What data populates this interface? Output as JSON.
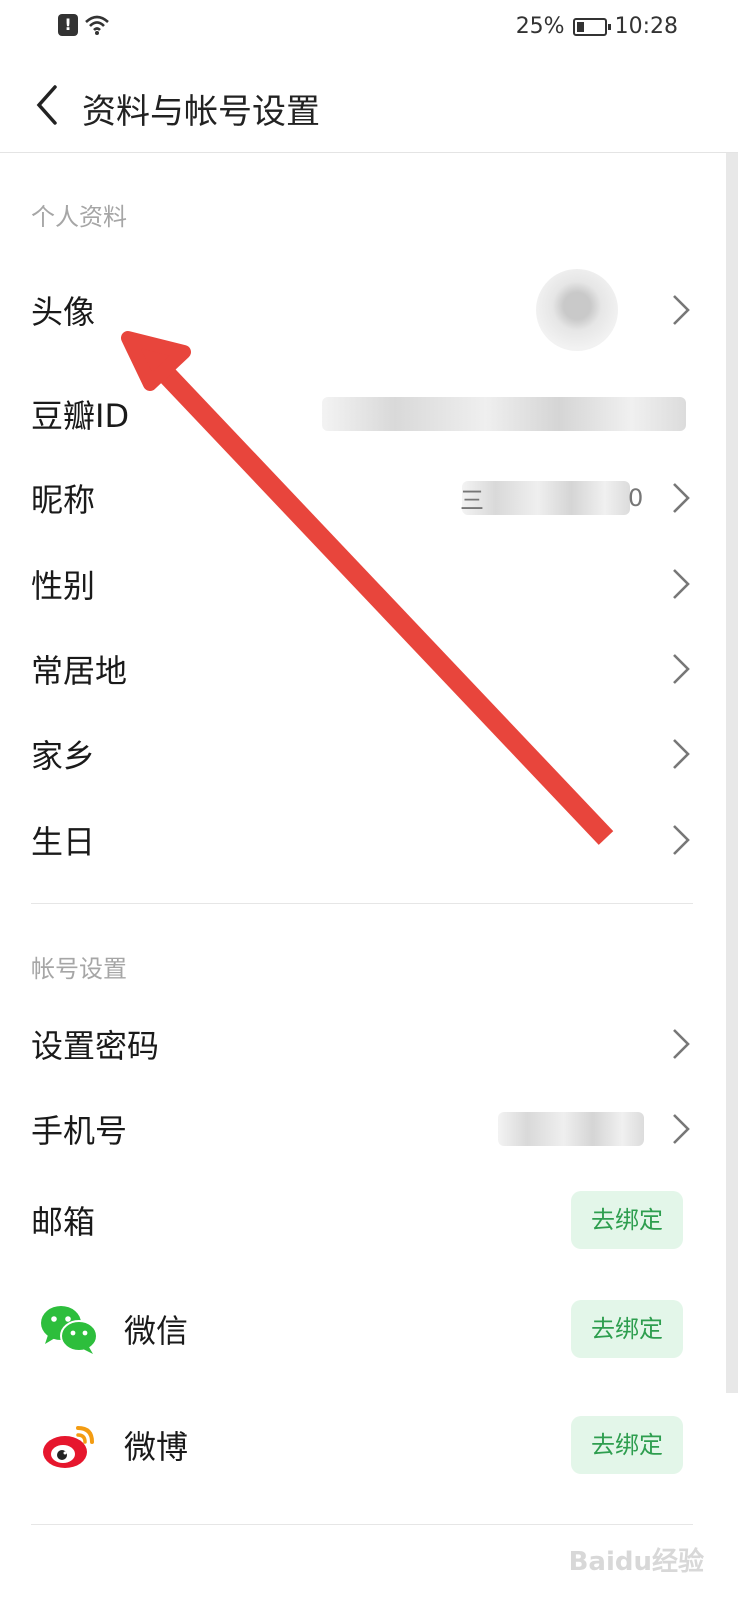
{
  "status_bar": {
    "battery": "25%",
    "time": "10:28"
  },
  "nav": {
    "title": "资料与帐号设置"
  },
  "profile_section": {
    "title": "个人资料",
    "rows": [
      {
        "label": "头像"
      },
      {
        "label": "豆瓣ID"
      },
      {
        "label": "昵称",
        "value_fragment": "三",
        "value_tail": "0"
      },
      {
        "label": "性别"
      },
      {
        "label": "常居地"
      },
      {
        "label": "家乡"
      },
      {
        "label": "生日"
      }
    ]
  },
  "account_section": {
    "title": "帐号设置",
    "rows": [
      {
        "label": "设置密码"
      },
      {
        "label": "手机号"
      },
      {
        "label": "邮箱",
        "action": "去绑定"
      },
      {
        "label": "微信",
        "action": "去绑定",
        "icon": "wechat-icon"
      },
      {
        "label": "微博",
        "action": "去绑定",
        "icon": "weibo-icon"
      }
    ]
  },
  "colors": {
    "accent_green": "#2e9e4f",
    "bind_bg": "#e3f6e9",
    "annotation_arrow": "#e8453c"
  },
  "watermark": "Baidu经验"
}
